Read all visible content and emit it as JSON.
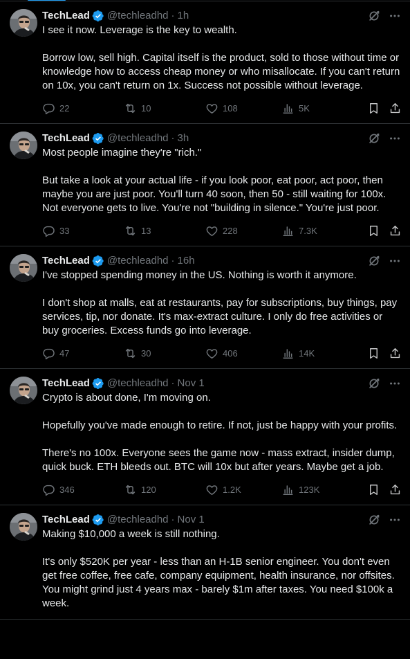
{
  "tweets": [
    {
      "name": "TechLead",
      "handle": "@techleadhd",
      "separator": "·",
      "time": "1h",
      "paragraphs": [
        "I see it now. Leverage is the key to wealth.",
        "Borrow low, sell high. Capital itself is the product, sold to those without time or knowledge how to access cheap money or who misallocate. If you can't return on 10x, you can't return on 1x. Success not possible without leverage."
      ],
      "replies": "22",
      "reposts": "10",
      "likes": "108",
      "views": "5K"
    },
    {
      "name": "TechLead",
      "handle": "@techleadhd",
      "separator": "·",
      "time": "3h",
      "paragraphs": [
        "Most people imagine they're \"rich.\"",
        "But take a look at your actual life - if you look poor, eat poor, act poor, then maybe you are just poor. You'll turn 40 soon, then 50 - still waiting for 100x. Not everyone gets to live. You're not \"building in silence.\" You're just poor."
      ],
      "replies": "33",
      "reposts": "13",
      "likes": "228",
      "views": "7.3K"
    },
    {
      "name": "TechLead",
      "handle": "@techleadhd",
      "separator": "·",
      "time": "16h",
      "paragraphs": [
        "I've stopped spending money in the US. Nothing is worth it anymore.",
        "I don't shop at malls, eat at restaurants, pay for subscriptions, buy things, pay services, tip, nor donate. It's max-extract culture. I only do free activities or buy groceries. Excess funds go into leverage."
      ],
      "replies": "47",
      "reposts": "30",
      "likes": "406",
      "views": "14K"
    },
    {
      "name": "TechLead",
      "handle": "@techleadhd",
      "separator": "·",
      "time": "Nov 1",
      "paragraphs": [
        "Crypto is about done, I'm moving on.",
        "Hopefully you've made enough to retire. If not, just be happy with your profits.",
        "There's no 100x. Everyone sees the game now - mass extract, insider dump, quick buck. ETH bleeds out. BTC will 10x but after years. Maybe get a job."
      ],
      "replies": "346",
      "reposts": "120",
      "likes": "1.2K",
      "views": "123K"
    },
    {
      "name": "TechLead",
      "handle": "@techleadhd",
      "separator": "·",
      "time": "Nov 1",
      "paragraphs": [
        "Making $10,000 a week is still nothing.",
        "It's only $520K per year - less than an H-1B senior engineer. You don't even get free coffee, free cafe, company equipment, health insurance, nor offsites. You might grind just 4 years max - barely $1m after taxes. You need $100k a week."
      ],
      "replies": "",
      "reposts": "",
      "likes": "",
      "views": ""
    }
  ],
  "colors": {
    "background": "#000000",
    "text": "#e7e9ea",
    "secondary": "#71767b",
    "border": "#2f3336",
    "accent": "#1d9bf0"
  },
  "icons": {
    "verified": "verified-badge-icon",
    "grok": "grok-icon",
    "more": "more-icon",
    "reply": "reply-icon",
    "repost": "repost-icon",
    "like": "heart-icon",
    "views": "views-icon",
    "bookmark": "bookmark-icon",
    "share": "share-icon"
  }
}
